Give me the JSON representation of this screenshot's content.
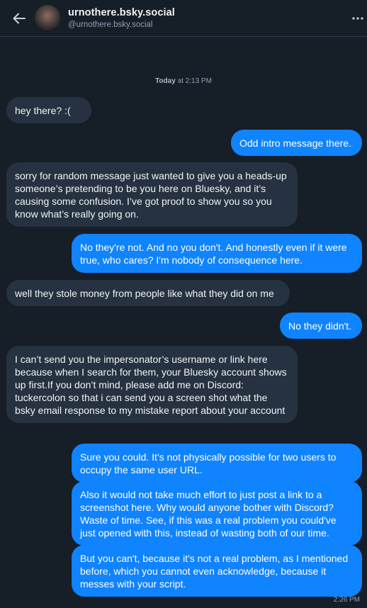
{
  "header": {
    "display_name": "urnothere.bsky.social",
    "handle": "@urnothere.bsky.social"
  },
  "conversation": {
    "date_label": "Today",
    "time_label": "at 2:13 PM",
    "messages": [
      {
        "side": "in",
        "text": "hey there? :("
      },
      {
        "side": "out",
        "text": "Odd intro message there."
      },
      {
        "side": "in",
        "text": "sorry for random message just wanted to give you a heads-up someone’s pretending to be you here on Bluesky, and it’s causing some confusion. I’ve got proof to show you so you know what’s really going on."
      },
      {
        "side": "out",
        "text": "No they're not. And no you don't. And honestly even if it were true, who cares? I'm nobody of consequence here."
      },
      {
        "side": "in",
        "text": "well they stole money from people like what they did on me"
      },
      {
        "side": "out",
        "text": "No they didn't."
      },
      {
        "side": "in",
        "text": "I can’t send you the impersonator’s username or link here because when I search for them, your Bluesky account shows up first.If you don’t mind, please add me on Discord: tuckercolon so that i can send you a screen shot what the bsky email response to my mistake report about your account"
      },
      {
        "side": "out",
        "text": "Sure you could. It's not physically possible for two users to occupy the same user URL."
      },
      {
        "side": "out",
        "text": "Also it would not take much effort to just post a link to a screenshot here. Why would anyone bother with Discord? Waste of time. See, if this was a real problem you could've just opened with this, instead of wasting both of our time."
      },
      {
        "side": "out",
        "text": "But you can't, because it's not a real problem, as I mentioned before, which you cannot even acknowledge, because it messes with your script."
      }
    ],
    "last_message_time": "2:26 PM"
  },
  "colors": {
    "background": "#161e27",
    "incoming_bubble": "#263241",
    "outgoing_bubble": "#1083fe"
  },
  "icons": [
    "arrow-left-icon",
    "ellipsis-icon"
  ]
}
